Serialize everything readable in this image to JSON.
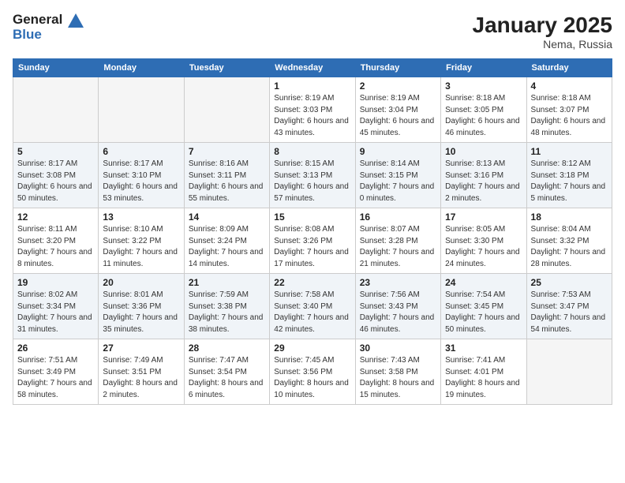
{
  "logo": {
    "line1": "General",
    "line2": "Blue"
  },
  "title": "January 2025",
  "location": "Nema, Russia",
  "weekdays": [
    "Sunday",
    "Monday",
    "Tuesday",
    "Wednesday",
    "Thursday",
    "Friday",
    "Saturday"
  ],
  "weeks": [
    [
      {
        "day": "",
        "sunrise": "",
        "sunset": "",
        "daylight": "",
        "empty": true
      },
      {
        "day": "",
        "sunrise": "",
        "sunset": "",
        "daylight": "",
        "empty": true
      },
      {
        "day": "",
        "sunrise": "",
        "sunset": "",
        "daylight": "",
        "empty": true
      },
      {
        "day": "1",
        "sunrise": "Sunrise: 8:19 AM",
        "sunset": "Sunset: 3:03 PM",
        "daylight": "Daylight: 6 hours and 43 minutes."
      },
      {
        "day": "2",
        "sunrise": "Sunrise: 8:19 AM",
        "sunset": "Sunset: 3:04 PM",
        "daylight": "Daylight: 6 hours and 45 minutes."
      },
      {
        "day": "3",
        "sunrise": "Sunrise: 8:18 AM",
        "sunset": "Sunset: 3:05 PM",
        "daylight": "Daylight: 6 hours and 46 minutes."
      },
      {
        "day": "4",
        "sunrise": "Sunrise: 8:18 AM",
        "sunset": "Sunset: 3:07 PM",
        "daylight": "Daylight: 6 hours and 48 minutes."
      }
    ],
    [
      {
        "day": "5",
        "sunrise": "Sunrise: 8:17 AM",
        "sunset": "Sunset: 3:08 PM",
        "daylight": "Daylight: 6 hours and 50 minutes."
      },
      {
        "day": "6",
        "sunrise": "Sunrise: 8:17 AM",
        "sunset": "Sunset: 3:10 PM",
        "daylight": "Daylight: 6 hours and 53 minutes."
      },
      {
        "day": "7",
        "sunrise": "Sunrise: 8:16 AM",
        "sunset": "Sunset: 3:11 PM",
        "daylight": "Daylight: 6 hours and 55 minutes."
      },
      {
        "day": "8",
        "sunrise": "Sunrise: 8:15 AM",
        "sunset": "Sunset: 3:13 PM",
        "daylight": "Daylight: 6 hours and 57 minutes."
      },
      {
        "day": "9",
        "sunrise": "Sunrise: 8:14 AM",
        "sunset": "Sunset: 3:15 PM",
        "daylight": "Daylight: 7 hours and 0 minutes."
      },
      {
        "day": "10",
        "sunrise": "Sunrise: 8:13 AM",
        "sunset": "Sunset: 3:16 PM",
        "daylight": "Daylight: 7 hours and 2 minutes."
      },
      {
        "day": "11",
        "sunrise": "Sunrise: 8:12 AM",
        "sunset": "Sunset: 3:18 PM",
        "daylight": "Daylight: 7 hours and 5 minutes."
      }
    ],
    [
      {
        "day": "12",
        "sunrise": "Sunrise: 8:11 AM",
        "sunset": "Sunset: 3:20 PM",
        "daylight": "Daylight: 7 hours and 8 minutes."
      },
      {
        "day": "13",
        "sunrise": "Sunrise: 8:10 AM",
        "sunset": "Sunset: 3:22 PM",
        "daylight": "Daylight: 7 hours and 11 minutes."
      },
      {
        "day": "14",
        "sunrise": "Sunrise: 8:09 AM",
        "sunset": "Sunset: 3:24 PM",
        "daylight": "Daylight: 7 hours and 14 minutes."
      },
      {
        "day": "15",
        "sunrise": "Sunrise: 8:08 AM",
        "sunset": "Sunset: 3:26 PM",
        "daylight": "Daylight: 7 hours and 17 minutes."
      },
      {
        "day": "16",
        "sunrise": "Sunrise: 8:07 AM",
        "sunset": "Sunset: 3:28 PM",
        "daylight": "Daylight: 7 hours and 21 minutes."
      },
      {
        "day": "17",
        "sunrise": "Sunrise: 8:05 AM",
        "sunset": "Sunset: 3:30 PM",
        "daylight": "Daylight: 7 hours and 24 minutes."
      },
      {
        "day": "18",
        "sunrise": "Sunrise: 8:04 AM",
        "sunset": "Sunset: 3:32 PM",
        "daylight": "Daylight: 7 hours and 28 minutes."
      }
    ],
    [
      {
        "day": "19",
        "sunrise": "Sunrise: 8:02 AM",
        "sunset": "Sunset: 3:34 PM",
        "daylight": "Daylight: 7 hours and 31 minutes."
      },
      {
        "day": "20",
        "sunrise": "Sunrise: 8:01 AM",
        "sunset": "Sunset: 3:36 PM",
        "daylight": "Daylight: 7 hours and 35 minutes."
      },
      {
        "day": "21",
        "sunrise": "Sunrise: 7:59 AM",
        "sunset": "Sunset: 3:38 PM",
        "daylight": "Daylight: 7 hours and 38 minutes."
      },
      {
        "day": "22",
        "sunrise": "Sunrise: 7:58 AM",
        "sunset": "Sunset: 3:40 PM",
        "daylight": "Daylight: 7 hours and 42 minutes."
      },
      {
        "day": "23",
        "sunrise": "Sunrise: 7:56 AM",
        "sunset": "Sunset: 3:43 PM",
        "daylight": "Daylight: 7 hours and 46 minutes."
      },
      {
        "day": "24",
        "sunrise": "Sunrise: 7:54 AM",
        "sunset": "Sunset: 3:45 PM",
        "daylight": "Daylight: 7 hours and 50 minutes."
      },
      {
        "day": "25",
        "sunrise": "Sunrise: 7:53 AM",
        "sunset": "Sunset: 3:47 PM",
        "daylight": "Daylight: 7 hours and 54 minutes."
      }
    ],
    [
      {
        "day": "26",
        "sunrise": "Sunrise: 7:51 AM",
        "sunset": "Sunset: 3:49 PM",
        "daylight": "Daylight: 7 hours and 58 minutes."
      },
      {
        "day": "27",
        "sunrise": "Sunrise: 7:49 AM",
        "sunset": "Sunset: 3:51 PM",
        "daylight": "Daylight: 8 hours and 2 minutes."
      },
      {
        "day": "28",
        "sunrise": "Sunrise: 7:47 AM",
        "sunset": "Sunset: 3:54 PM",
        "daylight": "Daylight: 8 hours and 6 minutes."
      },
      {
        "day": "29",
        "sunrise": "Sunrise: 7:45 AM",
        "sunset": "Sunset: 3:56 PM",
        "daylight": "Daylight: 8 hours and 10 minutes."
      },
      {
        "day": "30",
        "sunrise": "Sunrise: 7:43 AM",
        "sunset": "Sunset: 3:58 PM",
        "daylight": "Daylight: 8 hours and 15 minutes."
      },
      {
        "day": "31",
        "sunrise": "Sunrise: 7:41 AM",
        "sunset": "Sunset: 4:01 PM",
        "daylight": "Daylight: 8 hours and 19 minutes."
      },
      {
        "day": "",
        "sunrise": "",
        "sunset": "",
        "daylight": "",
        "empty": true
      }
    ]
  ]
}
